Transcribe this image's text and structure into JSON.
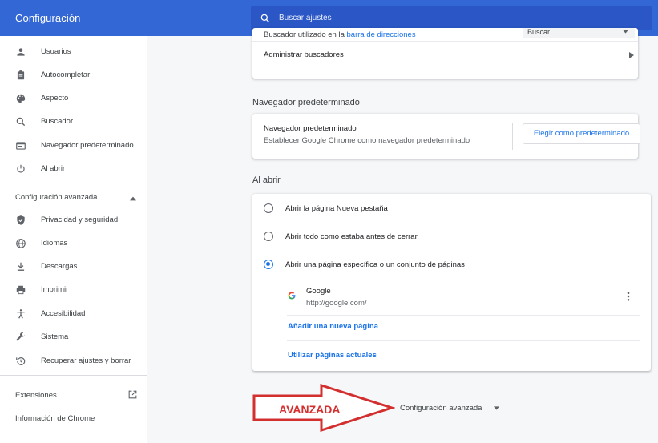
{
  "header": {
    "title": "Configuración",
    "search_placeholder": "Buscar ajustes"
  },
  "sidebar": {
    "items": [
      {
        "label": "Usuarios",
        "icon": "person-icon"
      },
      {
        "label": "Autocompletar",
        "icon": "clipboard-icon"
      },
      {
        "label": "Aspecto",
        "icon": "palette-icon"
      },
      {
        "label": "Buscador",
        "icon": "search-icon"
      },
      {
        "label": "Navegador predeterminado",
        "icon": "browser-icon"
      },
      {
        "label": "Al abrir",
        "icon": "power-icon"
      }
    ],
    "advanced_label": "Configuración avanzada",
    "advanced_items": [
      {
        "label": "Privacidad y seguridad",
        "icon": "shield-icon"
      },
      {
        "label": "Idiomas",
        "icon": "globe-icon"
      },
      {
        "label": "Descargas",
        "icon": "download-icon"
      },
      {
        "label": "Imprimir",
        "icon": "printer-icon"
      },
      {
        "label": "Accesibilidad",
        "icon": "accessibility-icon"
      },
      {
        "label": "Sistema",
        "icon": "wrench-icon"
      },
      {
        "label": "Recuperar ajustes y borrar",
        "icon": "restore-icon"
      }
    ],
    "extensions_label": "Extensiones",
    "about_label": "Información de Chrome"
  },
  "search_engine": {
    "partial_prefix": "Buscador utilizado en la ",
    "partial_link": "barra de direcciones",
    "partial_select_value": "Buscar",
    "manage_label": "Administrar buscadores"
  },
  "default_browser": {
    "section_title": "Navegador predeterminado",
    "title": "Navegador predeterminado",
    "subtitle": "Establecer Google Chrome como navegador predeterminado",
    "button_label": "Elegir como predeterminado"
  },
  "on_startup": {
    "section_title": "Al abrir",
    "options": [
      {
        "label": "Abrir la página Nueva pestaña",
        "checked": false
      },
      {
        "label": "Abrir todo como estaba antes de cerrar",
        "checked": false
      },
      {
        "label": "Abrir una página específica o un conjunto de páginas",
        "checked": true
      }
    ],
    "page": {
      "name": "Google",
      "url": "http://google.com/"
    },
    "add_page_label": "Añadir una nueva página",
    "use_current_label": "Utilizar páginas actuales"
  },
  "advanced_footer": {
    "label": "Configuración avanzada"
  },
  "annotation": {
    "arrow_text": "AVANZADA",
    "color": "#d32f2f"
  },
  "colors": {
    "header_bg": "#3367d6",
    "accent": "#1a73e8",
    "annotation_red": "#d32f2f"
  }
}
